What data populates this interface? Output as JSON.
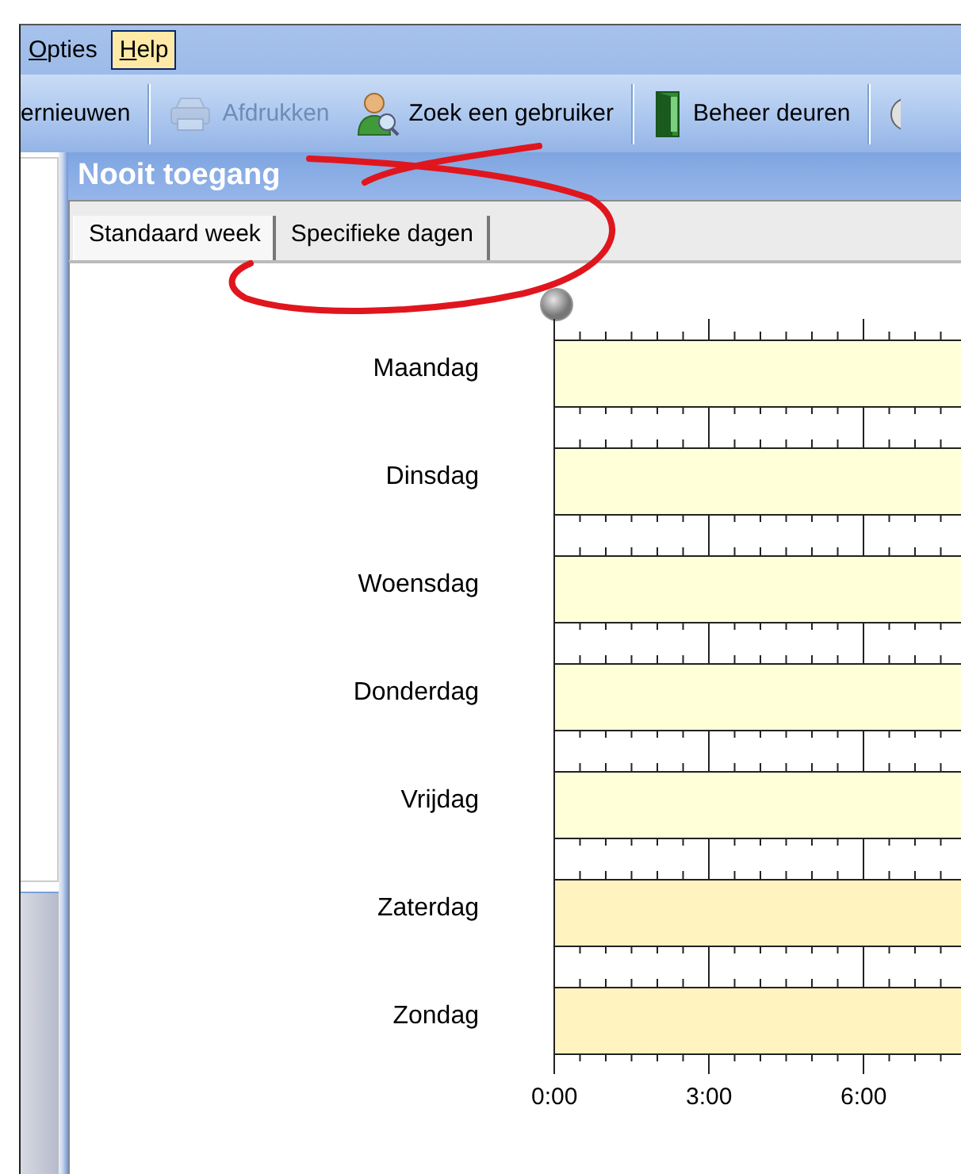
{
  "menu": [
    {
      "label": "Opties",
      "selected": false
    },
    {
      "label": "Help",
      "selected": true
    }
  ],
  "toolbar": [
    {
      "kind": "text",
      "label": "ernieuwen",
      "disabled": false
    },
    {
      "kind": "separator"
    },
    {
      "kind": "printer",
      "label": "Afdrukken",
      "disabled": true
    },
    {
      "kind": "user",
      "label": "Zoek een gebruiker",
      "disabled": false
    },
    {
      "kind": "separator"
    },
    {
      "kind": "door",
      "label": "Beheer deuren",
      "disabled": false
    },
    {
      "kind": "separator"
    }
  ],
  "panel": {
    "title": "Nooit toegang",
    "tabs": [
      {
        "label": "Standaard week",
        "selected": true
      },
      {
        "label": "Specifieke dagen",
        "selected": false
      }
    ]
  },
  "schedule": {
    "days": [
      {
        "label": "Maandag",
        "color": "#ffffd8"
      },
      {
        "label": "Dinsdag",
        "color": "#ffffd8"
      },
      {
        "label": "Woensdag",
        "color": "#ffffd8"
      },
      {
        "label": "Donderdag",
        "color": "#ffffd8"
      },
      {
        "label": "Vrijdag",
        "color": "#ffffd8"
      },
      {
        "label": "Zaterdag",
        "color": "#fff3c0"
      },
      {
        "label": "Zondag",
        "color": "#fff3c0"
      }
    ],
    "hours": [
      "0:00",
      "3:00",
      "6:00"
    ]
  }
}
